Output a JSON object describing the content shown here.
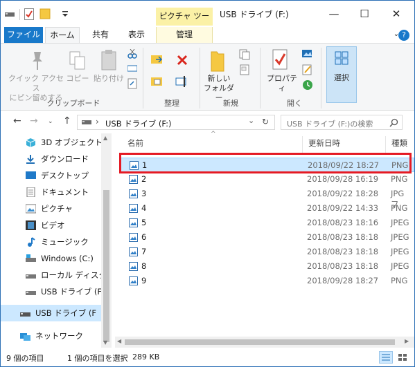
{
  "window": {
    "title": "USB ドライブ (F:)",
    "context_tab": "ピクチャ ツール"
  },
  "tabs": {
    "file": "ファイル",
    "home": "ホーム",
    "share": "共有",
    "view": "表示",
    "manage": "管理"
  },
  "ribbon": {
    "pin_quick_access": "クイック アクセス\nにピン留めする",
    "copy": "コピー",
    "paste": "貼り付け",
    "new_folder": "新しい\nフォルダー",
    "properties": "プロパティ",
    "select": "選択",
    "groups": {
      "clipboard": "クリップボード",
      "organize": "整理",
      "new": "新規",
      "open": "開く"
    }
  },
  "address": {
    "path": "USB ドライブ (F:)",
    "search_placeholder": "USB ドライブ (F:)の検索"
  },
  "nav_pane": [
    "3D オブジェクト",
    "ダウンロード",
    "デスクトップ",
    "ドキュメント",
    "ピクチャ",
    "ビデオ",
    "ミュージック",
    "Windows (C:)",
    "ローカル ディスク (D",
    "USB ドライブ (F:)",
    "USB ドライブ (F:)",
    "ネットワーク"
  ],
  "columns": {
    "name": "名前",
    "date": "更新日時",
    "type": "種類"
  },
  "files": [
    {
      "name": "1",
      "date": "2018/09/22 18:27",
      "type": "PNG"
    },
    {
      "name": "2",
      "date": "2018/09/28 16:19",
      "type": "PNG"
    },
    {
      "name": "3",
      "date": "2018/09/22 18:28",
      "type": "JPG フ"
    },
    {
      "name": "4",
      "date": "2018/09/22 14:33",
      "type": "PNG"
    },
    {
      "name": "5",
      "date": "2018/08/23 18:16",
      "type": "JPEG"
    },
    {
      "name": "6",
      "date": "2018/08/23 18:18",
      "type": "JPEG"
    },
    {
      "name": "7",
      "date": "2018/08/23 18:18",
      "type": "JPEG"
    },
    {
      "name": "8",
      "date": "2018/08/23 18:18",
      "type": "JPEG"
    },
    {
      "name": "9",
      "date": "2018/09/28 18:27",
      "type": "PNG"
    }
  ],
  "status": {
    "item_count": "9 個の項目",
    "selected": "1 個の項目を選択",
    "size": "289 KB"
  },
  "colors": {
    "accent": "#1979ca",
    "selection": "#cce8ff",
    "highlight_box": "#e51a24",
    "picture_tools": "#fbf1a6"
  }
}
